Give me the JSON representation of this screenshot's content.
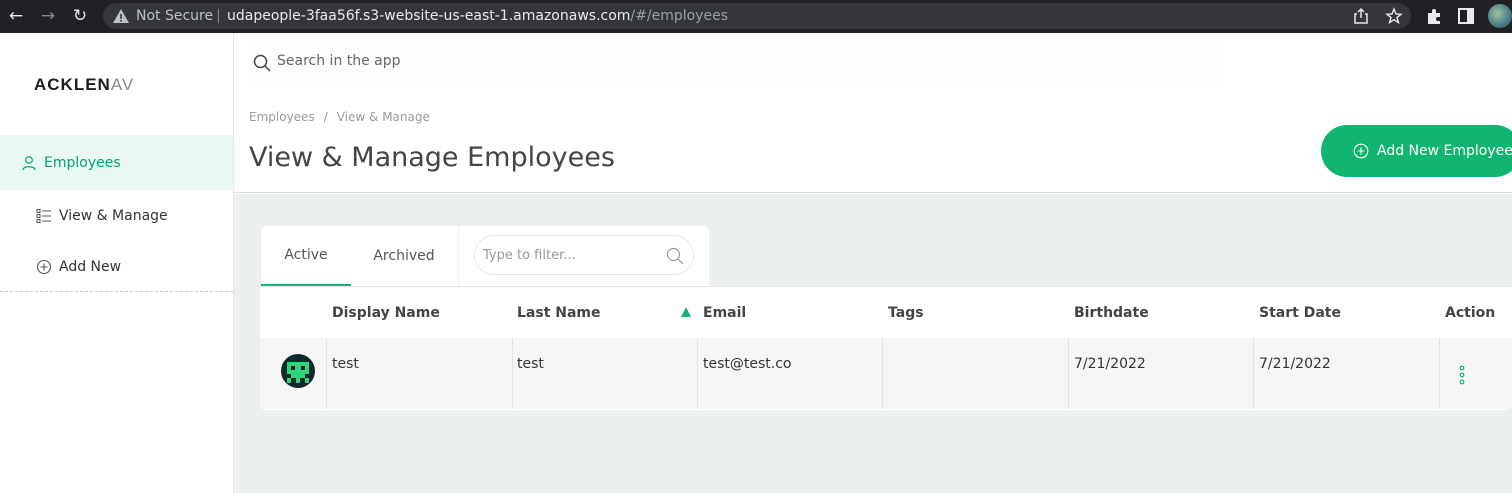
{
  "browser": {
    "security_label": "Not Secure",
    "url_host": "udapeople-3faa56f.s3-website-us-east-1.amazonaws.com",
    "url_path": "/#/employees"
  },
  "sidebar": {
    "logo_main": "ACKLEN",
    "logo_fade": "AV",
    "items": [
      {
        "label": "Employees",
        "icon": "user-icon"
      },
      {
        "label": "View & Manage",
        "icon": "list-icon"
      },
      {
        "label": "Add New",
        "icon": "plus-circle-icon"
      }
    ]
  },
  "search": {
    "placeholder": "Search in the app"
  },
  "header": {
    "breadcrumb": [
      "Employees",
      "View & Manage"
    ],
    "title": "View & Manage Employees",
    "add_button_label": "Add New Employee"
  },
  "tabs": [
    {
      "label": "Active",
      "selected": true
    },
    {
      "label": "Archived",
      "selected": false
    }
  ],
  "filter": {
    "placeholder": "Type to filter..."
  },
  "table": {
    "columns": [
      "Display Name",
      "Last Name",
      "Email",
      "Tags",
      "Birthdate",
      "Start Date",
      "Action"
    ],
    "sorted_column": "Email",
    "rows": [
      {
        "display_name": "test",
        "last_name": "test",
        "email": "test@test.co",
        "tags": "",
        "birthdate": "7/21/2022",
        "start_date": "7/21/2022"
      }
    ]
  },
  "colors": {
    "accent": "#10b56f",
    "active_bg": "#e9f8f2",
    "content_bg": "#ecf0ef"
  }
}
